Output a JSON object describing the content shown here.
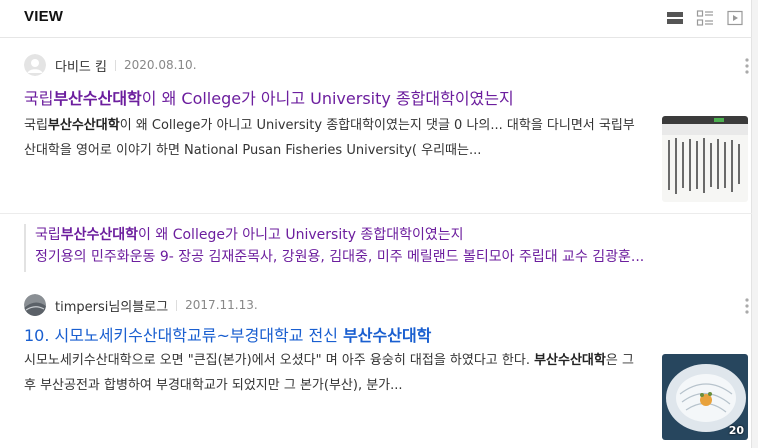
{
  "header": {
    "title": "VIEW",
    "view_modes": [
      "list-view-icon",
      "compact-list-icon",
      "video-view-icon"
    ]
  },
  "posts": [
    {
      "author": "다비드 킴",
      "date": "2020.08.10.",
      "title_pre": "국립",
      "title_highlight": "부산수산대학",
      "title_post": "이 왜 College가 아니고 University 종합대학이였는지",
      "snippet_pre": "국립",
      "snippet_highlight": "부산수산대학",
      "snippet_post": "이 왜 College가 아니고 University 종합대학이였는지 댓글 0 나의... 대학을 다니면서 국립부산대학을 영어로 이야기 하면 National Pusan Fisheries University( 우리때는...",
      "related": {
        "title_pre": "국립",
        "title_highlight": "부산수산대학",
        "title_post": "이 왜 College가 아니고 University 종합대학이였는지",
        "snippet": "정기용의 민주화운동 9- 장공 김재준목사, 강원용, 김대중, 미주 메릴랜드 볼티모아 주립대 교수 김광훈..."
      }
    },
    {
      "author": "timpersi님의블로그",
      "date": "2017.11.13.",
      "title_pre": "10. 시모노세키수산대학교류~부경대학교 전신 ",
      "title_highlight": "부산수산대학",
      "snippet_pre": "시모노세키수산대학으로 오면 \"큰집(본가)에서 오셨다\" 며 아주 융숭히 대접을 하였다고 한다. ",
      "snippet_highlight": "부산수산대학",
      "snippet_post": "은 그후 부산공전과 합병하여 부경대학교가 되었지만 그 본가(부산), 분가...",
      "thumb_count": "20"
    }
  ],
  "colors": {
    "visited_link": "#6c1e9e",
    "link": "#1a5fd0"
  }
}
